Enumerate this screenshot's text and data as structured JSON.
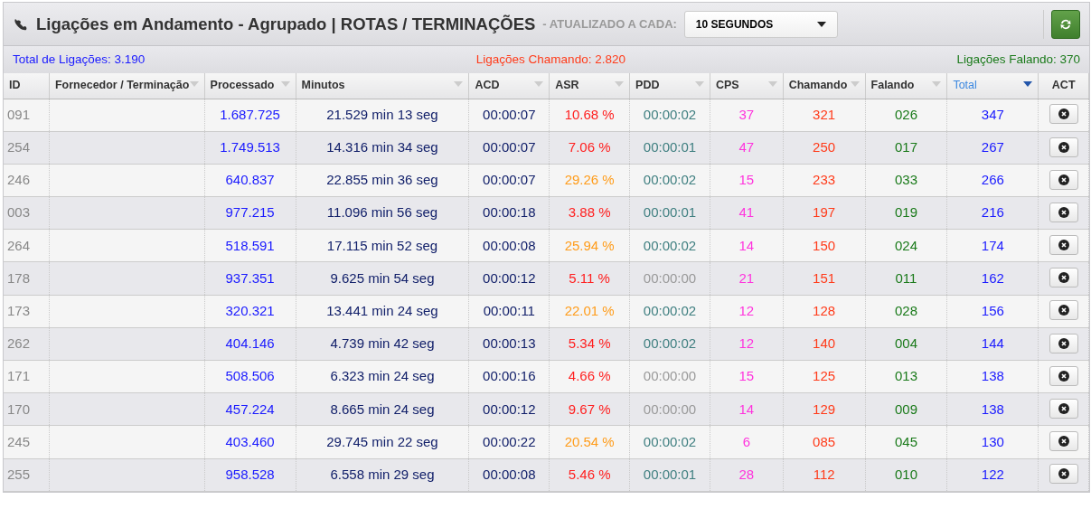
{
  "header": {
    "title": "Ligações em Andamento - Agrupado | ROTAS / TERMINAÇÕES",
    "refresh_label": "- ATUALIZADO A CADA:",
    "interval": "10 SEGUNDOS"
  },
  "summary": {
    "total": "Total de Ligações: 3.190",
    "calling": "Ligações Chamando: 2.820",
    "talking": "Ligações Falando: 370"
  },
  "table": {
    "columns": [
      {
        "label": "ID",
        "sortable": false,
        "sorted": false
      },
      {
        "label": "Fornecedor / Terminação",
        "sortable": true,
        "sorted": false
      },
      {
        "label": "Processado",
        "sortable": true,
        "sorted": false
      },
      {
        "label": "Minutos",
        "sortable": true,
        "sorted": false
      },
      {
        "label": "ACD",
        "sortable": true,
        "sorted": false
      },
      {
        "label": "ASR",
        "sortable": true,
        "sorted": false
      },
      {
        "label": "PDD",
        "sortable": true,
        "sorted": false
      },
      {
        "label": "CPS",
        "sortable": true,
        "sorted": false
      },
      {
        "label": "Chamando",
        "sortable": true,
        "sorted": false
      },
      {
        "label": "Falando",
        "sortable": true,
        "sorted": false
      },
      {
        "label": "Total",
        "sortable": true,
        "sorted": true
      },
      {
        "label": "ACT",
        "sortable": false,
        "sorted": false
      }
    ],
    "rows": [
      {
        "id": "091",
        "processado": "1.687.725",
        "minutos": "21.529 min 13 seg",
        "acd": "00:00:07",
        "asr": "10.68 %",
        "asr_low": true,
        "pdd": "00:00:02",
        "pdd_zero": false,
        "cps": "37",
        "chamando": "321",
        "falando": "026",
        "total": "347"
      },
      {
        "id": "254",
        "processado": "1.749.513",
        "minutos": "14.316 min 34 seg",
        "acd": "00:00:07",
        "asr": "7.06 %",
        "asr_low": true,
        "pdd": "00:00:01",
        "pdd_zero": false,
        "cps": "47",
        "chamando": "250",
        "falando": "017",
        "total": "267"
      },
      {
        "id": "246",
        "processado": "640.837",
        "minutos": "22.855 min 36 seg",
        "acd": "00:00:07",
        "asr": "29.26 %",
        "asr_low": false,
        "pdd": "00:00:02",
        "pdd_zero": false,
        "cps": "15",
        "chamando": "233",
        "falando": "033",
        "total": "266"
      },
      {
        "id": "003",
        "processado": "977.215",
        "minutos": "11.096 min 56 seg",
        "acd": "00:00:18",
        "asr": "3.88 %",
        "asr_low": true,
        "pdd": "00:00:01",
        "pdd_zero": false,
        "cps": "41",
        "chamando": "197",
        "falando": "019",
        "total": "216"
      },
      {
        "id": "264",
        "processado": "518.591",
        "minutos": "17.115 min 52 seg",
        "acd": "00:00:08",
        "asr": "25.94 %",
        "asr_low": false,
        "pdd": "00:00:02",
        "pdd_zero": false,
        "cps": "14",
        "chamando": "150",
        "falando": "024",
        "total": "174"
      },
      {
        "id": "178",
        "processado": "937.351",
        "minutos": "9.625 min 54 seg",
        "acd": "00:00:12",
        "asr": "5.11 %",
        "asr_low": true,
        "pdd": "00:00:00",
        "pdd_zero": true,
        "cps": "21",
        "chamando": "151",
        "falando": "011",
        "total": "162"
      },
      {
        "id": "173",
        "processado": "320.321",
        "minutos": "13.441 min 24 seg",
        "acd": "00:00:11",
        "asr": "22.01 %",
        "asr_low": false,
        "pdd": "00:00:02",
        "pdd_zero": false,
        "cps": "12",
        "chamando": "128",
        "falando": "028",
        "total": "156"
      },
      {
        "id": "262",
        "processado": "404.146",
        "minutos": "4.739 min 42 seg",
        "acd": "00:00:13",
        "asr": "5.34 %",
        "asr_low": true,
        "pdd": "00:00:02",
        "pdd_zero": false,
        "cps": "12",
        "chamando": "140",
        "falando": "004",
        "total": "144"
      },
      {
        "id": "171",
        "processado": "508.506",
        "minutos": "6.323 min 24 seg",
        "acd": "00:00:16",
        "asr": "4.66 %",
        "asr_low": true,
        "pdd": "00:00:00",
        "pdd_zero": true,
        "cps": "15",
        "chamando": "125",
        "falando": "013",
        "total": "138"
      },
      {
        "id": "170",
        "processado": "457.224",
        "minutos": "8.665 min 24 seg",
        "acd": "00:00:12",
        "asr": "9.67 %",
        "asr_low": true,
        "pdd": "00:00:00",
        "pdd_zero": true,
        "cps": "14",
        "chamando": "129",
        "falando": "009",
        "total": "138"
      },
      {
        "id": "245",
        "processado": "403.460",
        "minutos": "29.745 min 22 seg",
        "acd": "00:00:22",
        "asr": "20.54 %",
        "asr_low": false,
        "pdd": "00:00:02",
        "pdd_zero": false,
        "cps": "6",
        "chamando": "085",
        "falando": "045",
        "total": "130"
      },
      {
        "id": "255",
        "processado": "958.528",
        "minutos": "6.558 min 29 seg",
        "acd": "00:00:08",
        "asr": "5.46 %",
        "asr_low": true,
        "pdd": "00:00:01",
        "pdd_zero": false,
        "cps": "28",
        "chamando": "112",
        "falando": "010",
        "total": "122"
      }
    ]
  }
}
